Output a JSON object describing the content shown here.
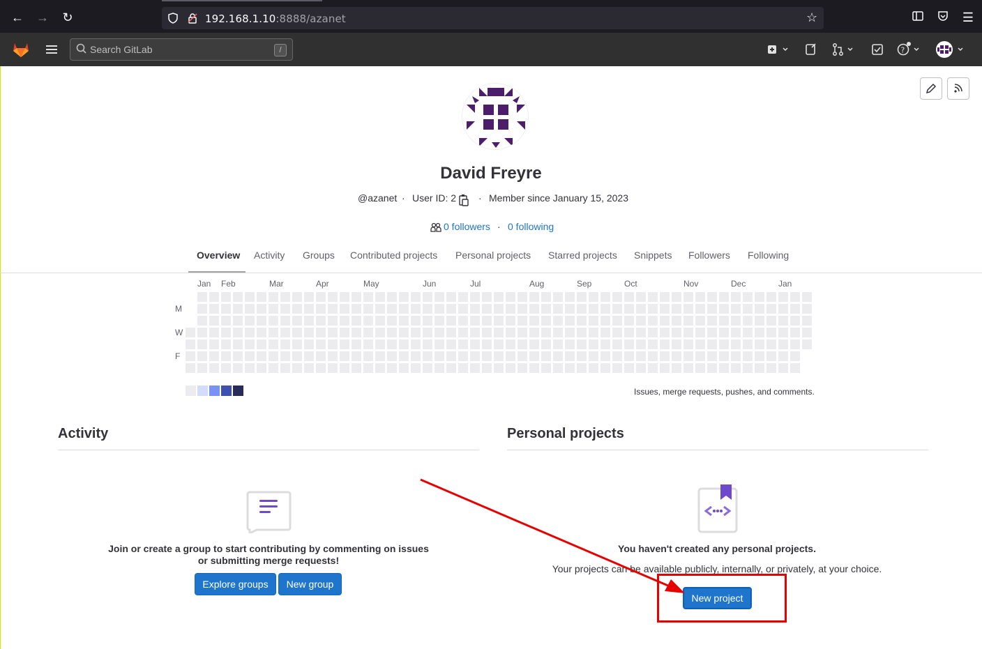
{
  "browser": {
    "url_host": "192.168.1.10",
    "url_rest": ":8888/azanet"
  },
  "header": {
    "search_placeholder": "Search GitLab",
    "search_shortcut": "/"
  },
  "profile": {
    "name": "David Freyre",
    "username": "@azanet",
    "user_id": "User ID: 2",
    "member_since": "Member since January 15, 2023",
    "followers": "0 followers",
    "following": "0 following"
  },
  "tabs": [
    {
      "label": "Overview"
    },
    {
      "label": "Activity"
    },
    {
      "label": "Groups"
    },
    {
      "label": "Contributed projects"
    },
    {
      "label": "Personal projects"
    },
    {
      "label": "Starred projects"
    },
    {
      "label": "Snippets"
    },
    {
      "label": "Followers"
    },
    {
      "label": "Following"
    }
  ],
  "calendar": {
    "months": [
      "Jan",
      "Feb",
      "Mar",
      "Apr",
      "May",
      "Jun",
      "Jul",
      "Aug",
      "Sep",
      "Oct",
      "Nov",
      "Dec",
      "Jan"
    ],
    "days": [
      "M",
      "W",
      "F"
    ],
    "caption": "Issues, merge requests, pushes, and comments.",
    "legend_colors": [
      "#ececef",
      "#d2dcff",
      "#7992f5",
      "#3f51ae",
      "#2a2b59"
    ]
  },
  "activity": {
    "title": "Activity",
    "empty_text": "Join or create a group to start contributing by commenting on issues or submitting merge requests!",
    "explore_button": "Explore groups",
    "new_group_button": "New group"
  },
  "projects": {
    "title": "Personal projects",
    "empty_title": "You haven't created any personal projects.",
    "empty_sub": "Your projects can be available publicly, internally, or privately, at your choice.",
    "new_project_button": "New project"
  },
  "colors": {
    "accent": "#1f75cb",
    "annotation": "#e60000"
  }
}
